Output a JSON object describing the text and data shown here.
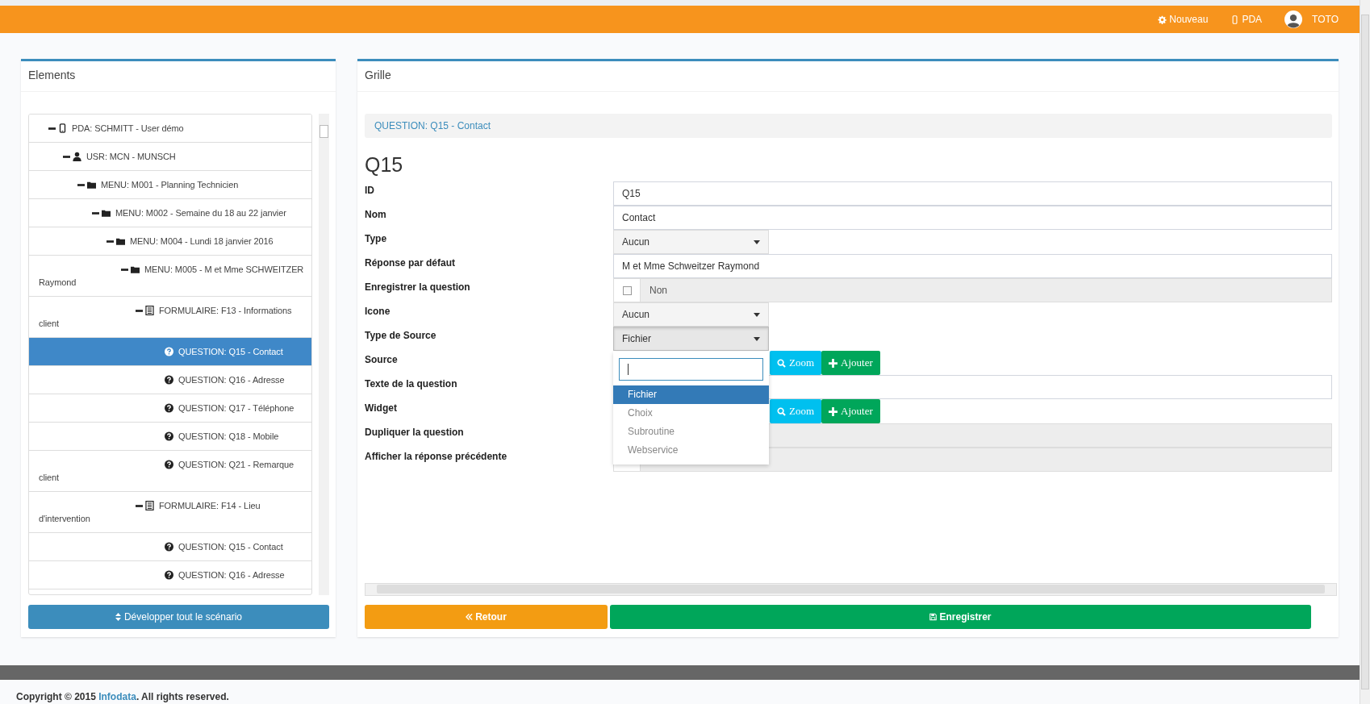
{
  "topbar": {
    "links": [
      {
        "label": "Nouveau"
      },
      {
        "label": "PDA"
      }
    ],
    "user": {
      "name": "TOTO"
    }
  },
  "elements": {
    "title": "Elements",
    "tree": [
      {
        "label": "PDA: SCHMITT - User démo",
        "kind": "pda",
        "expanded": true,
        "selected": false,
        "children": [
          {
            "label": "USR: MCN - MUNSCH",
            "kind": "user",
            "expanded": true,
            "selected": false,
            "children": [
              {
                "label": "MENU: M001 - Planning Technicien",
                "kind": "menu",
                "expanded": true,
                "selected": false,
                "children": [
                  {
                    "label": "MENU: M002 - Semaine du 18 au 22 janvier",
                    "kind": "menu",
                    "expanded": true,
                    "selected": false,
                    "children": [
                      {
                        "label": "MENU: M004 - Lundi 18 janvier 2016",
                        "kind": "menu",
                        "expanded": true,
                        "selected": false,
                        "children": [
                          {
                            "label": "MENU: M005 - M et Mme SCHWEITZER Raymond",
                            "kind": "menu",
                            "expanded": true,
                            "selected": false,
                            "children": [
                              {
                                "label": "FORMULAIRE: F13 - Informations client",
                                "kind": "form",
                                "expanded": true,
                                "selected": false,
                                "children": [
                                  {
                                    "label": "QUESTION: Q15 - Contact",
                                    "kind": "question",
                                    "selected": true
                                  },
                                  {
                                    "label": "QUESTION: Q16 - Adresse",
                                    "kind": "question",
                                    "selected": false
                                  },
                                  {
                                    "label": "QUESTION: Q17 - Téléphone",
                                    "kind": "question",
                                    "selected": false
                                  },
                                  {
                                    "label": "QUESTION: Q18 - Mobile",
                                    "kind": "question",
                                    "selected": false
                                  },
                                  {
                                    "label": "QUESTION: Q21 - Remarque client",
                                    "kind": "question",
                                    "selected": false
                                  }
                                ]
                              },
                              {
                                "label": "FORMULAIRE: F14 - Lieu d'intervention",
                                "kind": "form",
                                "expanded": true,
                                "selected": false,
                                "children": [
                                  {
                                    "label": "QUESTION: Q15 - Contact",
                                    "kind": "question",
                                    "selected": false
                                  },
                                  {
                                    "label": "QUESTION: Q16 - Adresse",
                                    "kind": "question",
                                    "selected": false
                                  }
                                ]
                              }
                            ]
                          }
                        ]
                      }
                    ]
                  }
                ]
              }
            ]
          }
        ]
      }
    ],
    "expand_button": "Développer tout le scénario"
  },
  "grille": {
    "title": "Grille",
    "breadcrumb": "QUESTION: Q15 - Contact",
    "heading": "Q15",
    "fields": [
      {
        "label": "ID",
        "kind": "text",
        "value": "Q15"
      },
      {
        "label": "Nom",
        "kind": "text",
        "value": "Contact"
      },
      {
        "label": "Type",
        "kind": "select",
        "value": "Aucun",
        "open": false
      },
      {
        "label": "Réponse par défaut",
        "kind": "text",
        "value": "M et Mme Schweitzer Raymond"
      },
      {
        "label": "Enregistrer la question",
        "kind": "checkbox",
        "checked": false,
        "value": "Non"
      },
      {
        "label": "Icone",
        "kind": "select",
        "value": "Aucun",
        "open": false
      },
      {
        "label": "Type de Source",
        "kind": "select",
        "value": "Fichier",
        "open": true,
        "options": [
          {
            "label": "Fichier",
            "selected": true
          },
          {
            "label": "Choix",
            "selected": false
          },
          {
            "label": "Subroutine",
            "selected": false
          },
          {
            "label": "Webservice",
            "selected": false
          }
        ]
      },
      {
        "label": "Source",
        "kind": "lookup",
        "buttons": [
          {
            "label": "Zoom",
            "kind": "zoom"
          },
          {
            "label": "Ajouter",
            "kind": "add"
          }
        ]
      },
      {
        "label": "Texte de la question",
        "kind": "text"
      },
      {
        "label": "Widget",
        "kind": "lookup",
        "buttons": [
          {
            "label": "Zoom",
            "kind": "zoom"
          },
          {
            "label": "Ajouter",
            "kind": "add"
          }
        ]
      },
      {
        "label": "Dupliquer la question",
        "kind": "checkbox"
      },
      {
        "label": "Afficher la réponse précédente",
        "kind": "checkbox"
      }
    ],
    "buttons": [
      {
        "label": "Retour",
        "kind": "back"
      },
      {
        "label": "Enregistrer",
        "kind": "save"
      }
    ]
  },
  "footer": {
    "before": "Copyright © 2015 ",
    "company": "Infodata",
    "after": ". All rights reserved."
  }
}
